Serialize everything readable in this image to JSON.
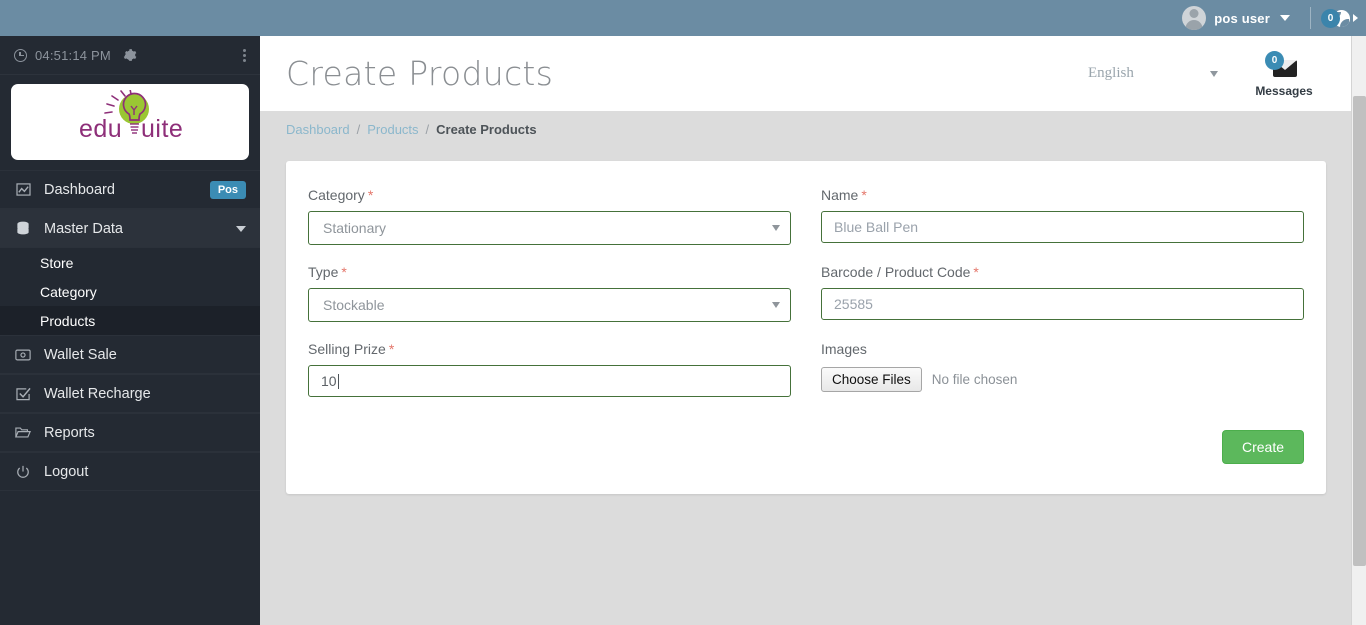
{
  "topbar": {
    "user_name": "pos user",
    "avatar_icon": "avatar-icon",
    "caret_icon": "chevron-down-icon",
    "globe_badge_count": "0",
    "globe_icon": "globe-icon"
  },
  "sidebar": {
    "clock_icon": "clock-icon",
    "time": "04:51:14 PM",
    "gear_icon": "gear-icon",
    "more_icon": "vertical-dots-icon",
    "logo_text": "eduSuite",
    "items": [
      {
        "label": "Dashboard",
        "icon": "chart-bars-icon",
        "badge": "Pos",
        "has_children": false
      },
      {
        "label": "Master Data",
        "icon": "database-icon",
        "badge": "",
        "has_children": true,
        "children": [
          {
            "label": "Store",
            "active": false
          },
          {
            "label": "Category",
            "active": false
          },
          {
            "label": "Products",
            "active": true
          }
        ]
      },
      {
        "label": "Wallet Sale",
        "icon": "wallet-icon",
        "badge": "",
        "has_children": false
      },
      {
        "label": "Wallet Recharge",
        "icon": "check-square-icon",
        "badge": "",
        "has_children": false
      },
      {
        "label": "Reports",
        "icon": "folder-icon",
        "badge": "",
        "has_children": false
      },
      {
        "label": "Logout",
        "icon": "power-icon",
        "badge": "",
        "has_children": false
      }
    ]
  },
  "header": {
    "title": "Create Products",
    "language": "English",
    "language_caret_icon": "caret-down-icon",
    "messages_label": "Messages",
    "messages_count": "0",
    "messages_icon": "envelope-icon"
  },
  "breadcrumb": {
    "items": [
      {
        "label": "Dashboard",
        "current": false
      },
      {
        "label": "Products",
        "current": false
      },
      {
        "label": "Create Products",
        "current": true
      }
    ],
    "separator": "/"
  },
  "form": {
    "category": {
      "label": "Category",
      "required": "*",
      "value": "Stationary",
      "caret_icon": "caret-down-icon"
    },
    "type": {
      "label": "Type",
      "required": "*",
      "value": "Stockable",
      "caret_icon": "caret-down-icon"
    },
    "selling_prize": {
      "label": "Selling Prize",
      "required": "*",
      "value": "10",
      "placeholder": ""
    },
    "name": {
      "label": "Name",
      "required": "*",
      "value": "",
      "placeholder": "Blue Ball Pen"
    },
    "barcode": {
      "label": "Barcode / Product Code",
      "required": "*",
      "value": "",
      "placeholder": "25585"
    },
    "images": {
      "label": "Images",
      "button_label": "Choose Files",
      "status_text": "No file chosen"
    },
    "submit_label": "Create"
  },
  "colors": {
    "topbar": "#6b8ca3",
    "sidebar": "#242a33",
    "accent_blue": "#3b8cb4",
    "input_border_green": "#45713a",
    "create_green": "#5cb85c",
    "required_red": "#e4766a",
    "page_bg": "#dcdcdc"
  }
}
